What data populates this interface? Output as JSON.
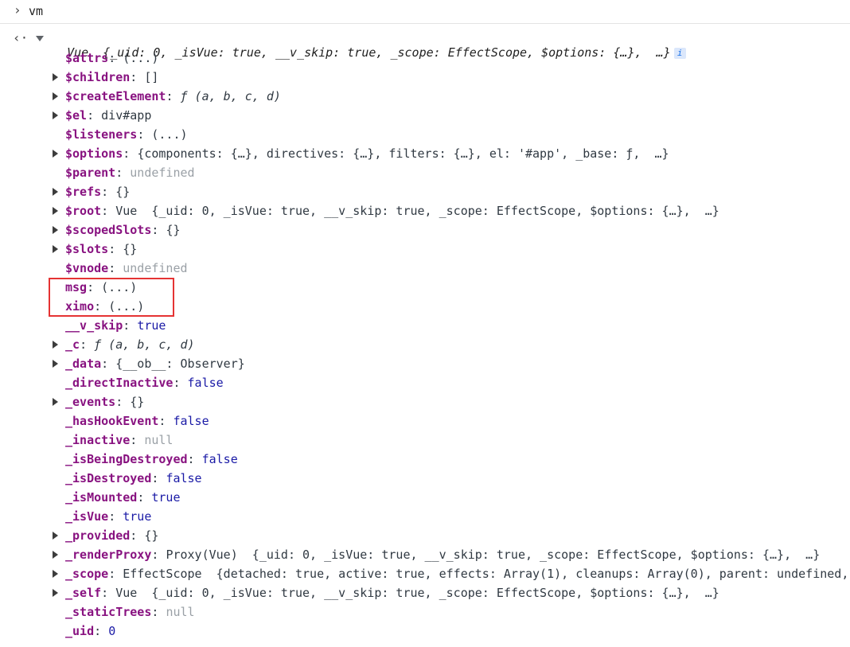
{
  "console": {
    "prompt_symbol": "›",
    "input": "vm",
    "output_symbol": "‹·",
    "root_summary": "Vue  {_uid: 0, _isVue: true, __v_skip: true, _scope: EffectScope, $options: {…},  …}",
    "info_icon": "i"
  },
  "rows": [
    {
      "key": "$attrs",
      "value": "(...)",
      "expandable": false,
      "style": "prev"
    },
    {
      "key": "$children",
      "value": "[]",
      "expandable": true,
      "style": "prev"
    },
    {
      "key": "$createElement",
      "value": "ƒ (a, b, c, d)",
      "expandable": true,
      "style": "fn"
    },
    {
      "key": "$el",
      "value": "div#app",
      "expandable": true,
      "style": "prev"
    },
    {
      "key": "$listeners",
      "value": "(...)",
      "expandable": false,
      "style": "prev"
    },
    {
      "key": "$options",
      "value": "{components: {…}, directives: {…}, filters: {…}, el: '#app', _base: ƒ,  …}",
      "expandable": true,
      "style": "prev"
    },
    {
      "key": "$parent",
      "value": "undefined",
      "expandable": false,
      "style": "dim"
    },
    {
      "key": "$refs",
      "value": "{}",
      "expandable": true,
      "style": "prev"
    },
    {
      "key": "$root",
      "value": "Vue  {_uid: 0, _isVue: true, __v_skip: true, _scope: EffectScope, $options: {…},  …}",
      "expandable": true,
      "style": "prev"
    },
    {
      "key": "$scopedSlots",
      "value": "{}",
      "expandable": true,
      "style": "prev"
    },
    {
      "key": "$slots",
      "value": "{}",
      "expandable": true,
      "style": "prev"
    },
    {
      "key": "$vnode",
      "value": "undefined",
      "expandable": false,
      "style": "dim"
    },
    {
      "key": "msg",
      "value": "(...)",
      "expandable": false,
      "style": "prev"
    },
    {
      "key": "ximo",
      "value": "(...)",
      "expandable": false,
      "style": "prev"
    },
    {
      "key": "__v_skip",
      "value": "true",
      "expandable": false,
      "style": "kw"
    },
    {
      "key": "_c",
      "value": "ƒ (a, b, c, d)",
      "expandable": true,
      "style": "fn"
    },
    {
      "key": "_data",
      "value": "{__ob__: Observer}",
      "expandable": true,
      "style": "prev"
    },
    {
      "key": "_directInactive",
      "value": "false",
      "expandable": false,
      "style": "kw"
    },
    {
      "key": "_events",
      "value": "{}",
      "expandable": true,
      "style": "prev"
    },
    {
      "key": "_hasHookEvent",
      "value": "false",
      "expandable": false,
      "style": "kw"
    },
    {
      "key": "_inactive",
      "value": "null",
      "expandable": false,
      "style": "dim"
    },
    {
      "key": "_isBeingDestroyed",
      "value": "false",
      "expandable": false,
      "style": "kw"
    },
    {
      "key": "_isDestroyed",
      "value": "false",
      "expandable": false,
      "style": "kw"
    },
    {
      "key": "_isMounted",
      "value": "true",
      "expandable": false,
      "style": "kw"
    },
    {
      "key": "_isVue",
      "value": "true",
      "expandable": false,
      "style": "kw"
    },
    {
      "key": "_provided",
      "value": "{}",
      "expandable": true,
      "style": "prev"
    },
    {
      "key": "_renderProxy",
      "value": "Proxy(Vue)  {_uid: 0, _isVue: true, __v_skip: true, _scope: EffectScope, $options: {…},  …}",
      "expandable": true,
      "style": "prev"
    },
    {
      "key": "_scope",
      "value": "EffectScope  {detached: true, active: true, effects: Array(1), cleanups: Array(0), parent: undefined,",
      "expandable": true,
      "style": "prev"
    },
    {
      "key": "_self",
      "value": "Vue  {_uid: 0, _isVue: true, __v_skip: true, _scope: EffectScope, $options: {…},  …}",
      "expandable": true,
      "style": "prev"
    },
    {
      "key": "_staticTrees",
      "value": "null",
      "expandable": false,
      "style": "dim"
    },
    {
      "key": "_uid",
      "value": "0",
      "expandable": false,
      "style": "kw"
    }
  ],
  "colors": {
    "highlight": "#e53333",
    "key": "#881280",
    "keyword": "#1a1aa6",
    "string": "#c41a16"
  }
}
